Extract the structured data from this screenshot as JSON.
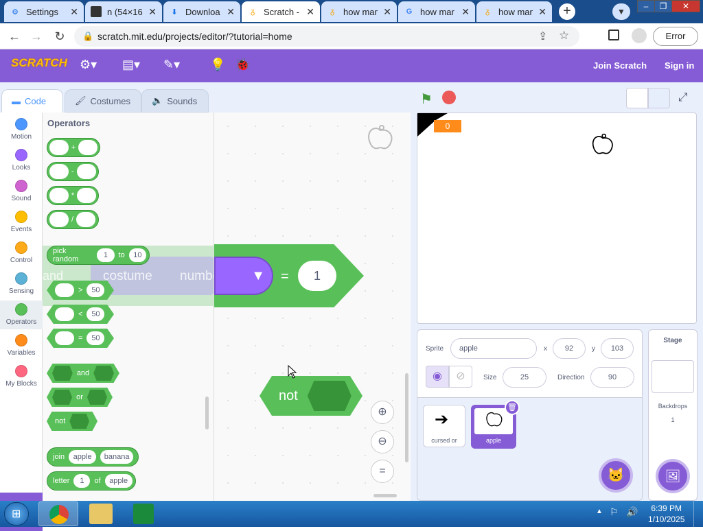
{
  "browser": {
    "tabs": [
      {
        "title": "Settings",
        "icon": "gear-icon"
      },
      {
        "title": "n (54×16",
        "icon": "image-icon"
      },
      {
        "title": "Downloa",
        "icon": "download-icon"
      },
      {
        "title": "Scratch -",
        "icon": "scratch-icon"
      },
      {
        "title": "how man",
        "icon": "scratch-icon"
      },
      {
        "title": "how mar",
        "icon": "google-icon"
      },
      {
        "title": "how man",
        "icon": "scratch-icon"
      }
    ],
    "new_tab": "+",
    "url": "scratch.mit.edu/projects/editor/?tutorial=home",
    "error_label": "Error"
  },
  "header": {
    "logo": "SCRATCH",
    "join": "Join Scratch",
    "sign_in": "Sign in"
  },
  "editor_tabs": [
    "Code",
    "Costumes",
    "Sounds"
  ],
  "categories": [
    {
      "label": "Motion",
      "color": "#4c97ff"
    },
    {
      "label": "Looks",
      "color": "#9966ff"
    },
    {
      "label": "Sound",
      "color": "#cf63cf"
    },
    {
      "label": "Events",
      "color": "#ffbf00"
    },
    {
      "label": "Control",
      "color": "#ffab19"
    },
    {
      "label": "Sensing",
      "color": "#5cb1d6"
    },
    {
      "label": "Operators",
      "color": "#59c059"
    },
    {
      "label": "Variables",
      "color": "#ff8c1a"
    },
    {
      "label": "My Blocks",
      "color": "#ff6680"
    }
  ],
  "palette": {
    "title": "Operators",
    "arith": [
      "+",
      "-",
      "*",
      "/"
    ],
    "pick_random": {
      "label": "pick random",
      "from": "1",
      "to_label": "to",
      "to": "10"
    },
    "compare": [
      {
        "op": ">",
        "value": "50"
      },
      {
        "op": "<",
        "value": "50"
      },
      {
        "op": "=",
        "value": "50"
      }
    ],
    "bool": [
      "and",
      "or",
      "not"
    ],
    "join": {
      "label": "join",
      "a": "apple",
      "b": "banana"
    },
    "letter": {
      "label": "letter",
      "n": "1",
      "of": "of",
      "word": "apple"
    }
  },
  "workspace": {
    "eq_block": {
      "reporter_and": "and",
      "costume": "costume",
      "number": "number",
      "eq": "=",
      "value": "1"
    },
    "not_block": "not"
  },
  "stage": {
    "counter": "0"
  },
  "sprite": {
    "label": "Sprite",
    "name": "apple",
    "x_label": "x",
    "x": "92",
    "y_label": "y",
    "y": "103",
    "size_label": "Size",
    "size": "25",
    "direction_label": "Direction",
    "direction": "90",
    "list": [
      {
        "name": "cursed or",
        "selected": false
      },
      {
        "name": "apple",
        "selected": true
      }
    ]
  },
  "stage_panel": {
    "title": "Stage",
    "backdrops_label": "Backdrops",
    "backdrops": "1"
  },
  "taskbar": {
    "time": "6:39 PM",
    "date": "1/10/2025"
  }
}
